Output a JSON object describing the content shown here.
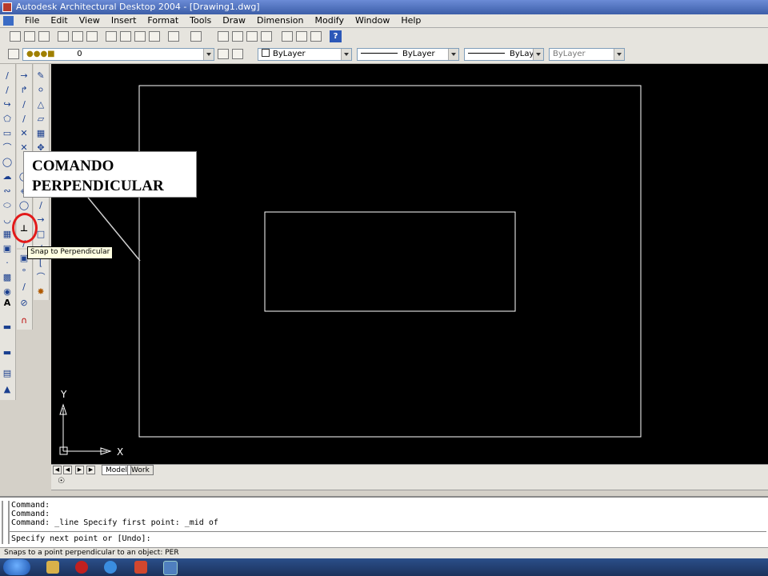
{
  "window": {
    "title": "Autodesk Architectural Desktop 2004 - [Drawing1.dwg]"
  },
  "menu": [
    "File",
    "Edit",
    "View",
    "Insert",
    "Format",
    "Tools",
    "Draw",
    "Dimension",
    "Modify",
    "Window",
    "Help"
  ],
  "toolbar": {
    "layer_value": "0",
    "color_value": "ByLayer",
    "linetype_value": "ByLayer",
    "lineweight_value": "ByLayer",
    "plotstyle_value": "ByLayer",
    "help_glyph": "?"
  },
  "annotation": {
    "callout_line1": "COMANDO",
    "callout_line2": "PERPENDICULAR",
    "tooltip": "Snap to Perpendicular"
  },
  "ucs": {
    "y": "Y",
    "x": "X"
  },
  "layout_tabs": {
    "model": "Model",
    "work": "Work"
  },
  "command_history": [
    "Command:",
    "Command:",
    "Command: _line Specify first point: _mid of"
  ],
  "command_prompt": "Specify next point or [Undo]:",
  "status": "Snaps to a point perpendicular to an object: PER",
  "colors": {
    "canvas": "#000000",
    "drawing_lines": "#ffffff",
    "highlight_circle": "#e21a1a",
    "tooltip_bg": "#ffffe1"
  }
}
